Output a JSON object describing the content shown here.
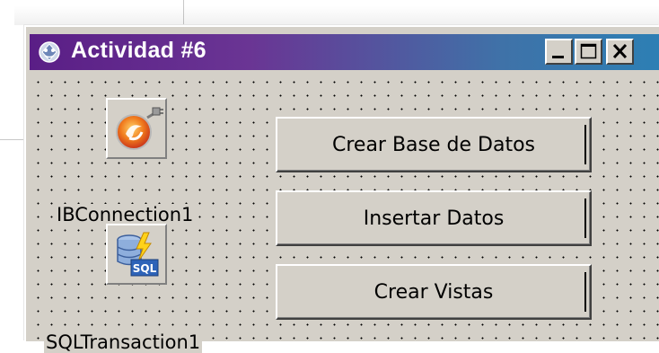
{
  "window": {
    "title": "Actividad #6",
    "title_icon": "delphi-app-icon",
    "controls": {
      "minimize": "minimize",
      "maximize": "maximize",
      "close": "close"
    },
    "titlebar_colors": [
      "#5a1e86",
      "#2d7fb4"
    ]
  },
  "components": [
    {
      "label": "IBConnection1",
      "icon": "firebird-database-icon"
    },
    {
      "label": "SQLTransaction1",
      "icon": "sql-transaction-icon"
    }
  ],
  "buttons": [
    {
      "label": "Crear Base de Datos"
    },
    {
      "label": "Insertar Datos"
    },
    {
      "label": "Crear Vistas"
    }
  ]
}
